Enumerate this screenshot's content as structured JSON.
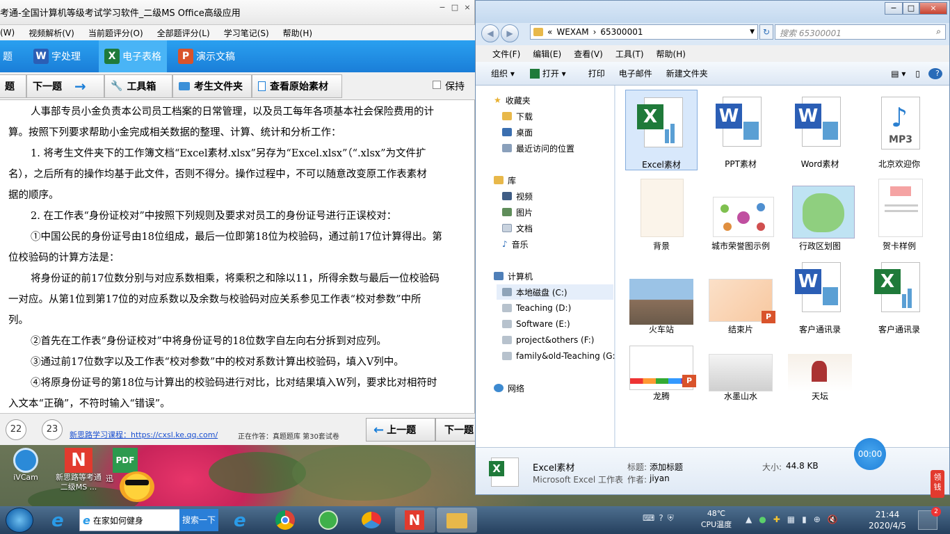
{
  "exam": {
    "title": "考通-全国计算机等级考试学习软件_二级MS Office高级应用",
    "menu": [
      "(W)",
      "视频解析(V)",
      "当前题评分(O)",
      "全部题评分(L)",
      "学习笔记(S)",
      "帮助(H)"
    ],
    "band": {
      "prefix": "题",
      "word": "字处理",
      "excel": "电子表格",
      "ppt": "演示文稿"
    },
    "tools": {
      "prev_cut": "题",
      "next": "下一题",
      "toolbox": "工具箱",
      "folder": "考生文件夹",
      "source": "查看原始素材",
      "keep": "保持"
    },
    "body": [
      "人事部专员小金负责本公司员工档案的日常管理，以及员工每年各项基本社会保险费用的计",
      "算。按照下列要求帮助小金完成相关数据的整理、计算、统计和分析工作：",
      "1. 将考生文件夹下的工作簿文档“Excel素材.xlsx”另存为“Excel.xlsx”（“.xlsx”为文件扩",
      "名），之后所有的操作均基于此文件，否则不得分。操作过程中，不可以随意改变原工作表素材",
      "据的顺序。",
      "2. 在工作表“身份证校对”中按照下列规则及要求对员工的身份证号进行正误校对：",
      "①中国公民的身份证号由18位组成，最后一位即第18位为校验码，通过前17位计算得出。第",
      "位校验码的计算方法是：",
      "将身份证的前17位数分别与对应系数相乘，将乘积之和除以11，所得余数与最后一位校验码",
      "一对应。从第1位到第17位的对应系数以及余数与校验码对应关系参见工作表“校对参数”中所",
      "列。",
      "②首先在工作表“身份证校对”中将身份证号的18位数字自左向右分拆到对应列。",
      "③通过前17位数字以及工作表“校对参数”中的校对系数计算出校验码，填入V列中。",
      "④将原身份证号的第18位与计算出的校验码进行对比，比对结果填入W列，要求比对相符时",
      "入文本“正确”，不符时输入“错误”。"
    ],
    "footer": {
      "n1": "22",
      "n2": "23",
      "link": "新思路学习课程：https://cxsl.ke.qq.com/",
      "status": "正在作答：真题题库 第30套试卷",
      "prev": "上一题",
      "next": "下一题"
    }
  },
  "explorer": {
    "breadcrumb": [
      "«",
      "WEXAM",
      "›",
      "65300001"
    ],
    "search_placeholder": "搜索 65300001",
    "menu": [
      "文件(F)",
      "编辑(E)",
      "查看(V)",
      "工具(T)",
      "帮助(H)"
    ],
    "cmd": [
      "组织 ▾",
      "打开 ▾",
      "打印",
      "电子邮件",
      "新建文件夹"
    ],
    "nav": {
      "favorites": "收藏夹",
      "download": "下载",
      "desktop": "桌面",
      "recent": "最近访问的位置",
      "library": "库",
      "video": "视频",
      "pictures": "图片",
      "docs": "文档",
      "music": "音乐",
      "computer": "计算机",
      "c": "本地磁盘 (C:)",
      "d": "Teaching (D:)",
      "e": "Software (E:)",
      "f": "project&others (F:)",
      "g": "family&old-Teaching (G:)",
      "network": "网络"
    },
    "files": [
      "Excel素材",
      "PPT素材",
      "Word素材",
      "北京欢迎你",
      "背景",
      "城市荣誉图示例",
      "行政区划图",
      "贺卡样例",
      "火车站",
      "结束片",
      "客户通讯录",
      "客户通讯录",
      "龙腾",
      "水墨山水",
      "天坛"
    ],
    "mp3_text": "MP3",
    "details": {
      "name": "Excel素材",
      "type": "Microsoft Excel 工作表",
      "title_label": "标题:",
      "title_val": "添加标题",
      "author_label": "作者:",
      "author_val": "jiyan",
      "size_label": "大小:",
      "size_val": "44.8 KB"
    }
  },
  "desktop": {
    "icons": [
      "iVCam",
      "新思路等考通二级MS ...",
      "迅"
    ],
    "timer": "00:00",
    "side_tag": "领钱"
  },
  "taskbar": {
    "search_text": "在家如何健身",
    "search_btn": "搜索一下",
    "temp": "48℃",
    "temp_label": "CPU温度",
    "time": "21:44",
    "date": "2020/4/5",
    "badge": "2"
  },
  "colors": {
    "accent": "#1a7ed8",
    "excel": "#1f7a3a",
    "word": "#2b5eb5",
    "ppt": "#d9532b"
  }
}
